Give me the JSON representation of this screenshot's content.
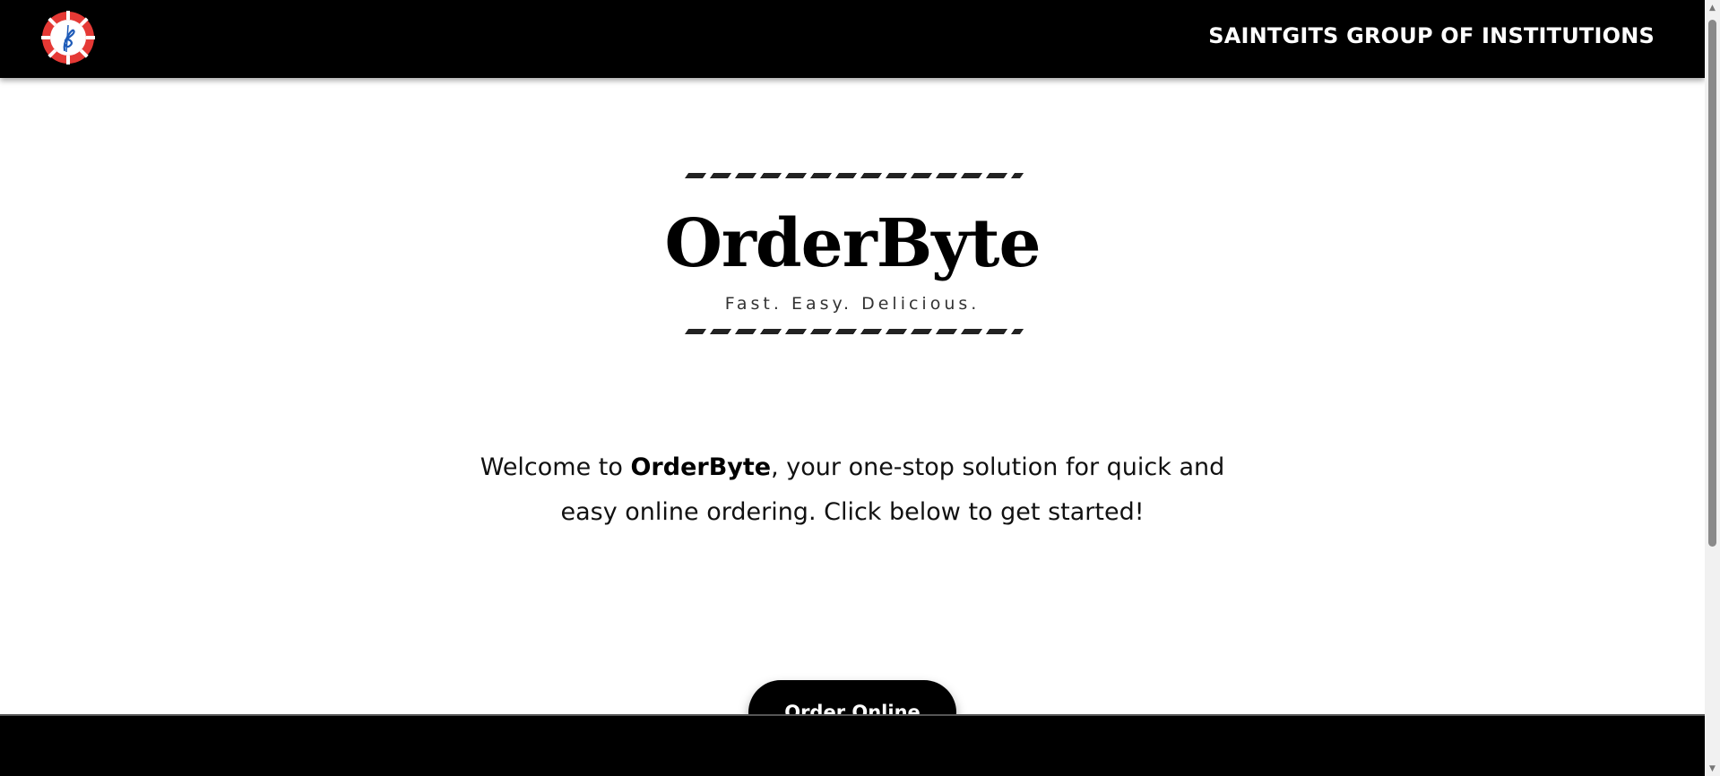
{
  "header": {
    "logo_icon": "saintgits-logo-icon",
    "institution_name": "SAINTGITS GROUP OF INSTITUTIONS"
  },
  "hero": {
    "brand_title": "OrderByte",
    "tagline": "Fast. Easy. Delicious.",
    "welcome_prefix": "Welcome to ",
    "welcome_brand": "OrderByte",
    "welcome_suffix": ", your one-stop solution for quick and easy online ordering. Click below to get started!",
    "cta_label": "Order Online"
  },
  "colors": {
    "header_bg": "#000000",
    "logo_red": "#e53935",
    "logo_blue": "#1e5bb8",
    "button_bg": "#000000",
    "button_text": "#ffffff"
  }
}
